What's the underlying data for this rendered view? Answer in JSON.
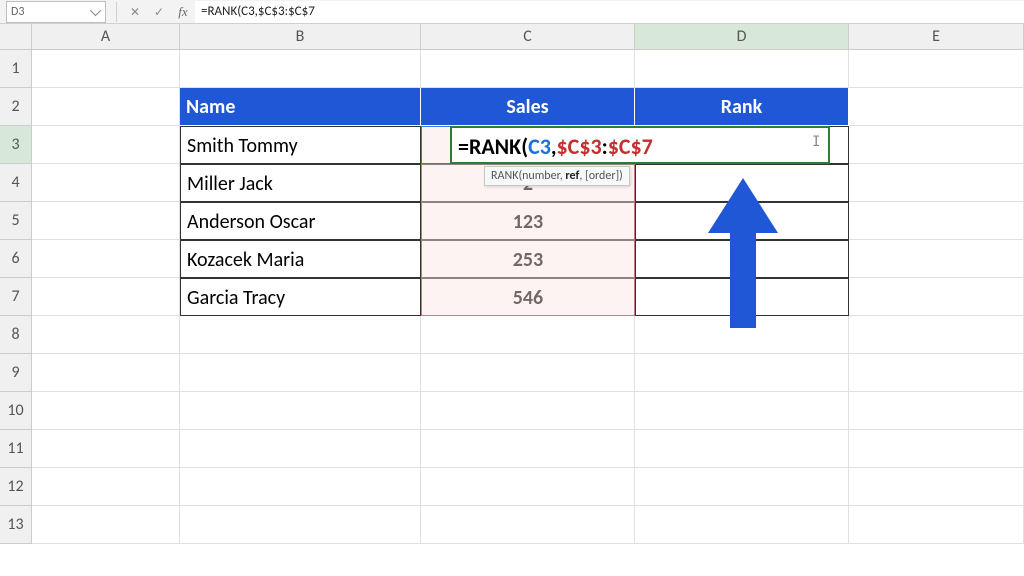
{
  "formula_bar": {
    "name_box": "D3",
    "cancel_glyph": "✕",
    "confirm_glyph": "✓",
    "fx_glyph": "fx",
    "formula_text": "=RANK(C3,$C$3:$C$7"
  },
  "columns": [
    "A",
    "B",
    "C",
    "D",
    "E"
  ],
  "row_numbers": [
    "1",
    "2",
    "3",
    "4",
    "5",
    "6",
    "7",
    "8",
    "9",
    "10",
    "11",
    "12",
    "13"
  ],
  "headers": {
    "name": "Name",
    "sales": "Sales",
    "rank": "Rank"
  },
  "data": [
    {
      "name": "Smith Tommy",
      "sales": ""
    },
    {
      "name": "Miller Jack",
      "sales": "2"
    },
    {
      "name": "Anderson Oscar",
      "sales": "123"
    },
    {
      "name": "Kozacek Maria",
      "sales": "253"
    },
    {
      "name": "Garcia Tracy",
      "sales": "546"
    }
  ],
  "editing": {
    "prefix": "=RANK(",
    "arg1": "C3",
    "comma": ",",
    "abs1": "$C$3",
    "colon": ":",
    "abs2": "$C$7"
  },
  "tooltip": {
    "fn": "RANK",
    "sig_pre": "(number, ",
    "sig_bold": "ref",
    "sig_post": ", [order])"
  },
  "colors": {
    "header_bg": "#1f57d6",
    "arrow": "#1f57d6"
  },
  "chart_data": {
    "type": "table",
    "columns": [
      "Name",
      "Sales",
      "Rank"
    ],
    "rows": [
      [
        "Smith Tommy",
        null,
        null
      ],
      [
        "Miller Jack",
        null,
        null
      ],
      [
        "Anderson Oscar",
        123,
        null
      ],
      [
        "Kozacek Maria",
        253,
        null
      ],
      [
        "Garcia Tracy",
        546,
        null
      ]
    ],
    "active_cell": "D3",
    "editing_formula": "=RANK(C3,$C$3:$C$7",
    "highlighted_ranges": {
      "arg1": "C3",
      "arg2": "C3:C7"
    }
  }
}
